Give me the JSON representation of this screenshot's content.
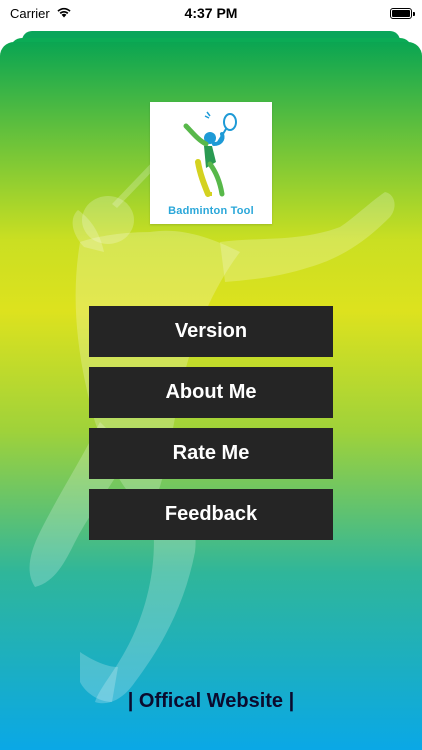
{
  "status_bar": {
    "carrier": "Carrier",
    "time": "4:37 PM",
    "wifi_icon": "wifi-icon",
    "battery_icon": "battery-icon"
  },
  "app": {
    "logo_text": "Badminton Tool"
  },
  "menu": {
    "items": [
      {
        "label": "Version"
      },
      {
        "label": "About Me"
      },
      {
        "label": "Rate Me"
      },
      {
        "label": "Feedback"
      }
    ]
  },
  "footer": {
    "website_link": "| Offical Website |"
  },
  "colors": {
    "button_bg": "#252525",
    "button_text": "#ffffff",
    "gradient_top": "#0aa552",
    "gradient_mid": "#dde21e",
    "gradient_bottom": "#0aa8e6"
  }
}
